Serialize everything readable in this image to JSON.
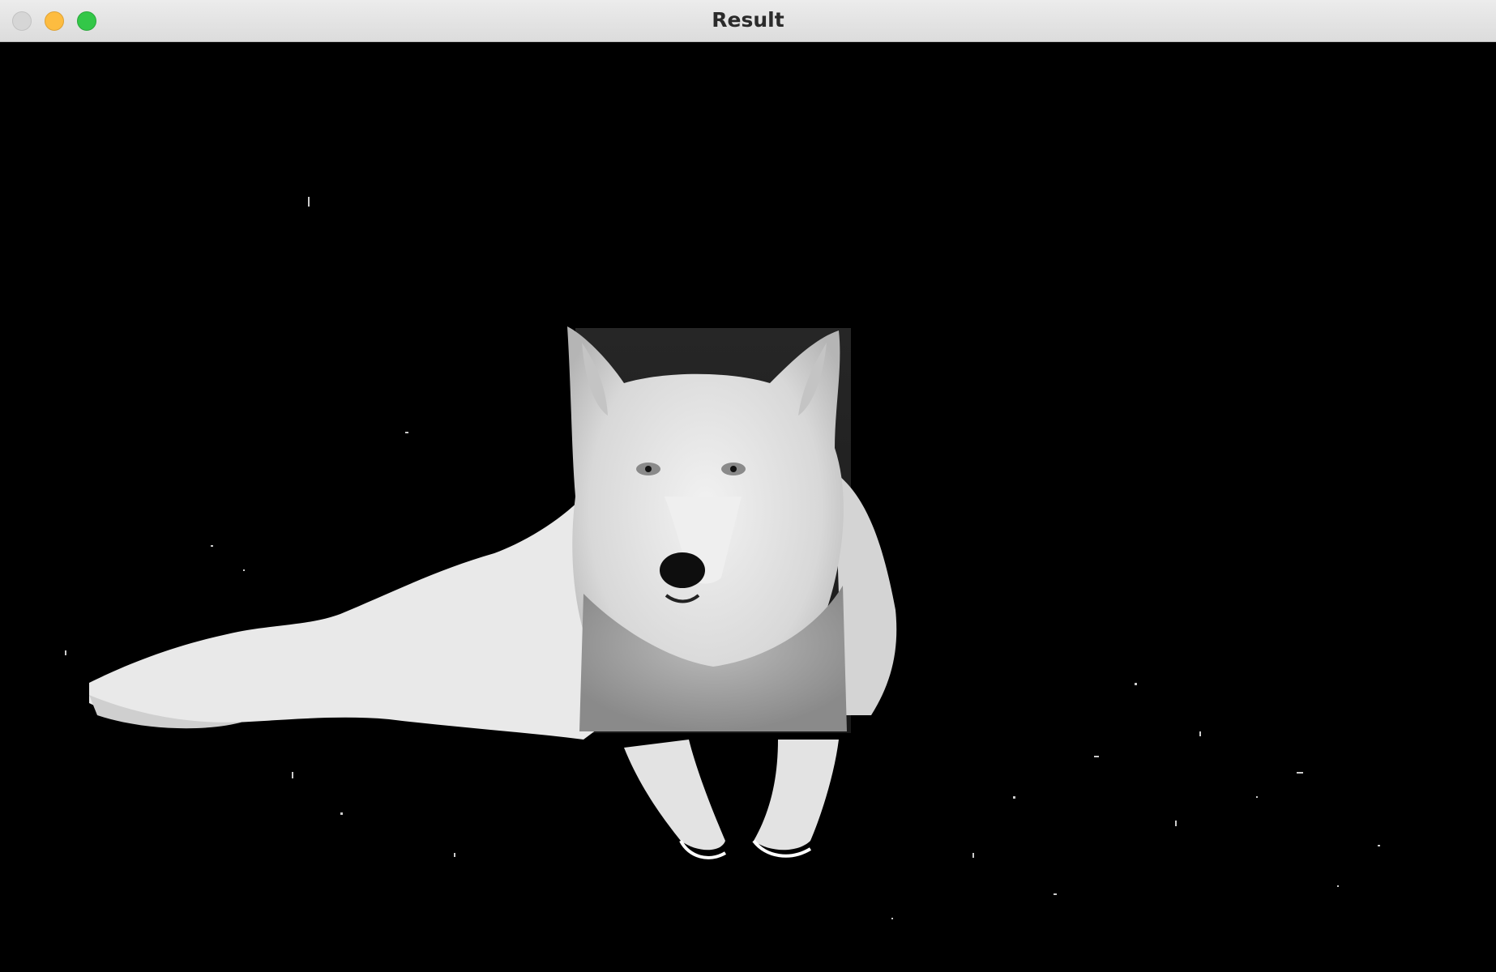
{
  "window": {
    "title": "Result"
  },
  "image": {
    "description_icon": "wolf-image",
    "background_color": "#000000",
    "subject_color": "#e6e6e6"
  }
}
